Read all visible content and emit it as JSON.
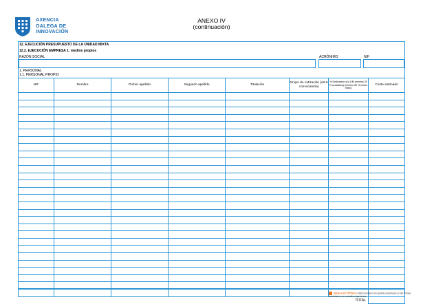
{
  "header": {
    "logo_lines": [
      "AXENCIA",
      "GALEGA DE",
      "INNOVACIÓN"
    ],
    "title": "ANEXO IV",
    "subtitle": "(continuación)"
  },
  "form": {
    "section_title": "12. EJECUCIÓN PRESUPUESTO DE LA UNIDAD MIXTA",
    "subsection_title": "12.2. EJECUCIÓN EMPRESA 1: medios propios",
    "razon_social_label": "RAZÓN SOCIAL",
    "acronimo_label": "ACRÓNIMO",
    "nif_label": "NIF",
    "personal_label": "1. PERSONAL",
    "personal_propio_label": "1.1. PERSONAL PROPIO"
  },
  "table": {
    "columns": [
      "NIF",
      "Nombre",
      "Primer apellido",
      "Segundo apellido",
      "Titulación",
      "Grupo de cotización (art.6 convocatoria)",
      "% Dedicación a la UM (mínimo 25 % consultiva) (mínimo 50 % centro mixto)",
      "Coste estimado"
    ],
    "total_label": "TOTAL"
  },
  "footer": {
    "brand": "SEDE ELECTRÓNICA",
    "text": "Esta formulario solo podrá presentarse en las formas previstas en su normativa reguladora"
  }
}
